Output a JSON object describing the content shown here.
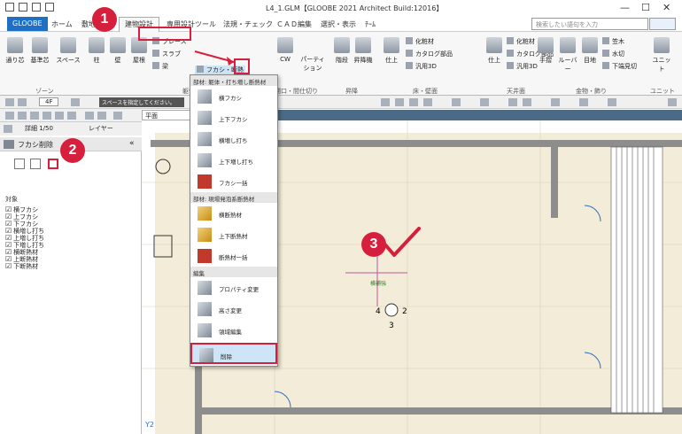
{
  "titlebar": {
    "title": "L4_1.GLM【GLOOBE 2021 Architect Build:12016】",
    "minimize": "—",
    "maximize": "☐",
    "close": "✕"
  },
  "tabs": [
    {
      "label": "GLOOBE"
    },
    {
      "label": "ホーム"
    },
    {
      "label": "敷地･外構"
    },
    {
      "label": "建物設計"
    },
    {
      "label": "専用設計ツール"
    },
    {
      "label": "法規・チェック"
    },
    {
      "label": "ＣＡＤ編集"
    },
    {
      "label": "選択・表示"
    },
    {
      "label": "ﾁｰﾑ"
    }
  ],
  "search": {
    "placeholder": "検索したい語句を入力"
  },
  "ribbon": {
    "zone_buttons": [
      "通り芯",
      "基準芯",
      "スペース"
    ],
    "frame_buttons": [
      "柱",
      "壁",
      "屋根"
    ],
    "brace": "ブレース",
    "slab": "スラブ",
    "beam": "梁",
    "fukashi": "フカシ・断熱",
    "cw": "CW",
    "partition": "パーティション",
    "stairs": "階段",
    "elevator": "昇降機",
    "finish1": "仕上",
    "finish2": "仕上",
    "makeup1": "化粧材",
    "catalog1": "カタログ部品",
    "generic1": "汎用3D",
    "makeup2": "化粧材",
    "catalog2": "カタログ部品",
    "generic2": "汎用3D",
    "handrail": "手摺",
    "louver": "ルーバー",
    "eaves": "目地",
    "fascia": "笠木",
    "drip": "水切",
    "ceiling_edge": "下端見切",
    "unit": "ユニット",
    "groups": [
      "ゾーン",
      "躯体",
      "開口・間仕切り",
      "昇降",
      "床・壁面",
      "天井面",
      "金物・飾り",
      "ユニット"
    ]
  },
  "toolbar": {
    "floor": "4F",
    "space_hint": "スペースを指定してください。",
    "scale": "詳細 1/50",
    "layer": "レイヤー",
    "view": "平面"
  },
  "panel": {
    "title": "フカシ削除",
    "target": "対象",
    "items": [
      "横フカシ",
      "上フカシ",
      "下フカシ",
      "横増し打ち",
      "上増し打ち",
      "下増し打ち",
      "横断熱材",
      "上断熱材",
      "下断熱材"
    ]
  },
  "dropdown": {
    "button": "フカシ・断熱",
    "section1": "部材: 躯体・打ち増し断熱材",
    "items1": [
      "横フカシ",
      "上下フカシ",
      "横増し打ち",
      "上下増し打ち",
      "フカシ一括"
    ],
    "section2": "部材: 現場発泡系断熱材",
    "items2": [
      "横断熱材",
      "上下断熱材",
      "断熱材一括"
    ],
    "section3": "編集",
    "items3": [
      "プロパティ変更",
      "高さ変更",
      "領域編集",
      "削除"
    ]
  },
  "callouts": [
    "1",
    "2",
    "3"
  ],
  "canvas": {
    "marker_label": "横補強",
    "nums": [
      "4",
      "2",
      "3"
    ],
    "grid_labels": [
      "Y2"
    ]
  },
  "colors": {
    "accent": "#d61f3c",
    "app_tab": "#1f6fc5",
    "floor": "#f3ecd8",
    "wall": "#8d8d8d"
  }
}
